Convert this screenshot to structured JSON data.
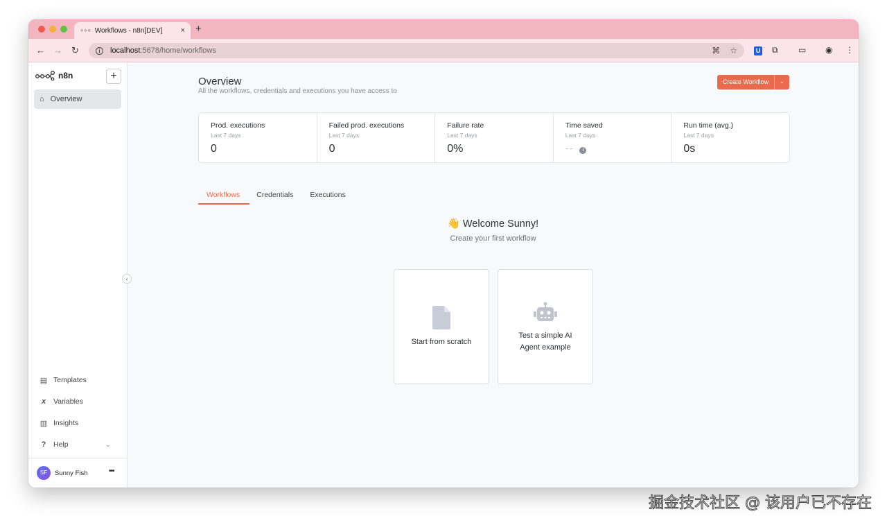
{
  "browser": {
    "tab_title": "Workflows - n8n[DEV]",
    "tab_close": "×",
    "new_tab": "+",
    "url_host": "localhost",
    "url_path": ":5678/home/workflows"
  },
  "sidebar": {
    "logo_text": "n8n",
    "add_label": "+",
    "active_item": "Overview",
    "bottom_items": {
      "templates": "Templates",
      "variables": "Variables",
      "insights": "Insights",
      "help": "Help"
    },
    "user": {
      "initials": "SF",
      "name": "Sunny Fish"
    },
    "collapse_icon": "‹"
  },
  "header": {
    "title": "Overview",
    "subtitle": "All the workflows, credentials and executions you have access to",
    "create_label": "Create Workflow"
  },
  "stats": [
    {
      "label": "Prod. executions",
      "period": "Last 7 days",
      "value": "0"
    },
    {
      "label": "Failed prod. executions",
      "period": "Last 7 days",
      "value": "0"
    },
    {
      "label": "Failure rate",
      "period": "Last 7 days",
      "value": "0%"
    },
    {
      "label": "Time saved",
      "period": "Last 7 days",
      "value": "--"
    },
    {
      "label": "Run time (avg.)",
      "period": "Last 7 days",
      "value": "0s"
    }
  ],
  "tabs": [
    "Workflows",
    "Credentials",
    "Executions"
  ],
  "welcome": {
    "title": "👋 Welcome Sunny!",
    "subtitle": "Create your first workflow"
  },
  "cards": {
    "scratch": "Start from scratch",
    "ai_line1": "Test a simple AI",
    "ai_line2": "Agent example"
  },
  "watermark": "掘金技术社区 @ 该用户已不存在",
  "colors": {
    "accent": "#ea6a4d",
    "tabbar": "#f3b6c1",
    "toolbar": "#fbe5ea"
  }
}
